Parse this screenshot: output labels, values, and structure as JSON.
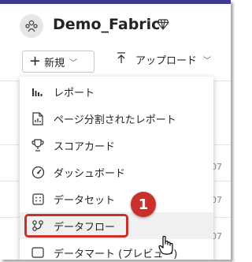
{
  "workspace": {
    "name": "Demo_Fabric",
    "icon": "workspace-people-icon",
    "premium_icon": "diamond-icon"
  },
  "toolbar": {
    "new_label": "新規",
    "upload_label": "アップロード"
  },
  "menu": {
    "items": [
      {
        "label": "レポート",
        "icon": "bar-chart-icon"
      },
      {
        "label": "ページ分割されたレポート",
        "icon": "paginated-report-icon"
      },
      {
        "label": "スコアカード",
        "icon": "trophy-icon"
      },
      {
        "label": "ダッシュボード",
        "icon": "gauge-icon"
      },
      {
        "label": "データセット",
        "icon": "dataset-grid-icon"
      },
      {
        "label": "データフロー",
        "icon": "dataflow-icon"
      },
      {
        "label": "データマート (プレビュー)",
        "icon": "datamart-icon"
      }
    ]
  },
  "annotation": {
    "step_number": "1",
    "color": "#c9302c"
  },
  "background": {
    "partial_texts": [
      "07",
      "07",
      "07"
    ]
  }
}
